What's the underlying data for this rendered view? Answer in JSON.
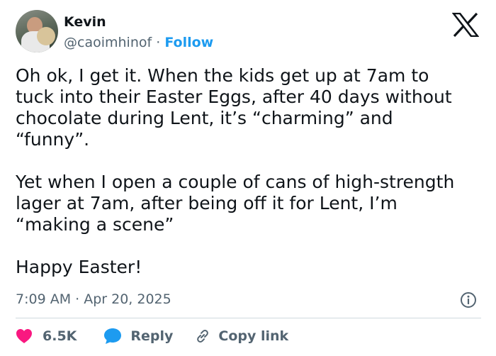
{
  "author": {
    "name": "Kevin",
    "handle": "@caoimhinof",
    "separator": "·",
    "follow_label": "Follow",
    "avatar_icon": "profile-photo"
  },
  "platform_icon": "x-logo-icon",
  "tweet": {
    "paragraph_1": "Oh ok, I get it. When the kids get up at 7am to\ntuck into their Easter Eggs, after 40 days without\nchocolate during Lent, it’s “charming” and\n“funny”.",
    "paragraph_2": "Yet when I open a couple of cans of high-strength\nlager at 7am, after being off it for Lent, I’m\n“making a scene”",
    "paragraph_3": "Happy Easter!"
  },
  "meta": {
    "timestamp": "7:09 AM · Apr 20, 2025",
    "info_icon": "info-icon"
  },
  "actions": {
    "likes_count": "6.5K",
    "reply_label": "Reply",
    "copy_link_label": "Copy link"
  },
  "colors": {
    "text": "#0f1419",
    "secondary": "#536471",
    "accent": "#1d9bf0",
    "like": "#f91880",
    "divider": "#cfd9de"
  }
}
